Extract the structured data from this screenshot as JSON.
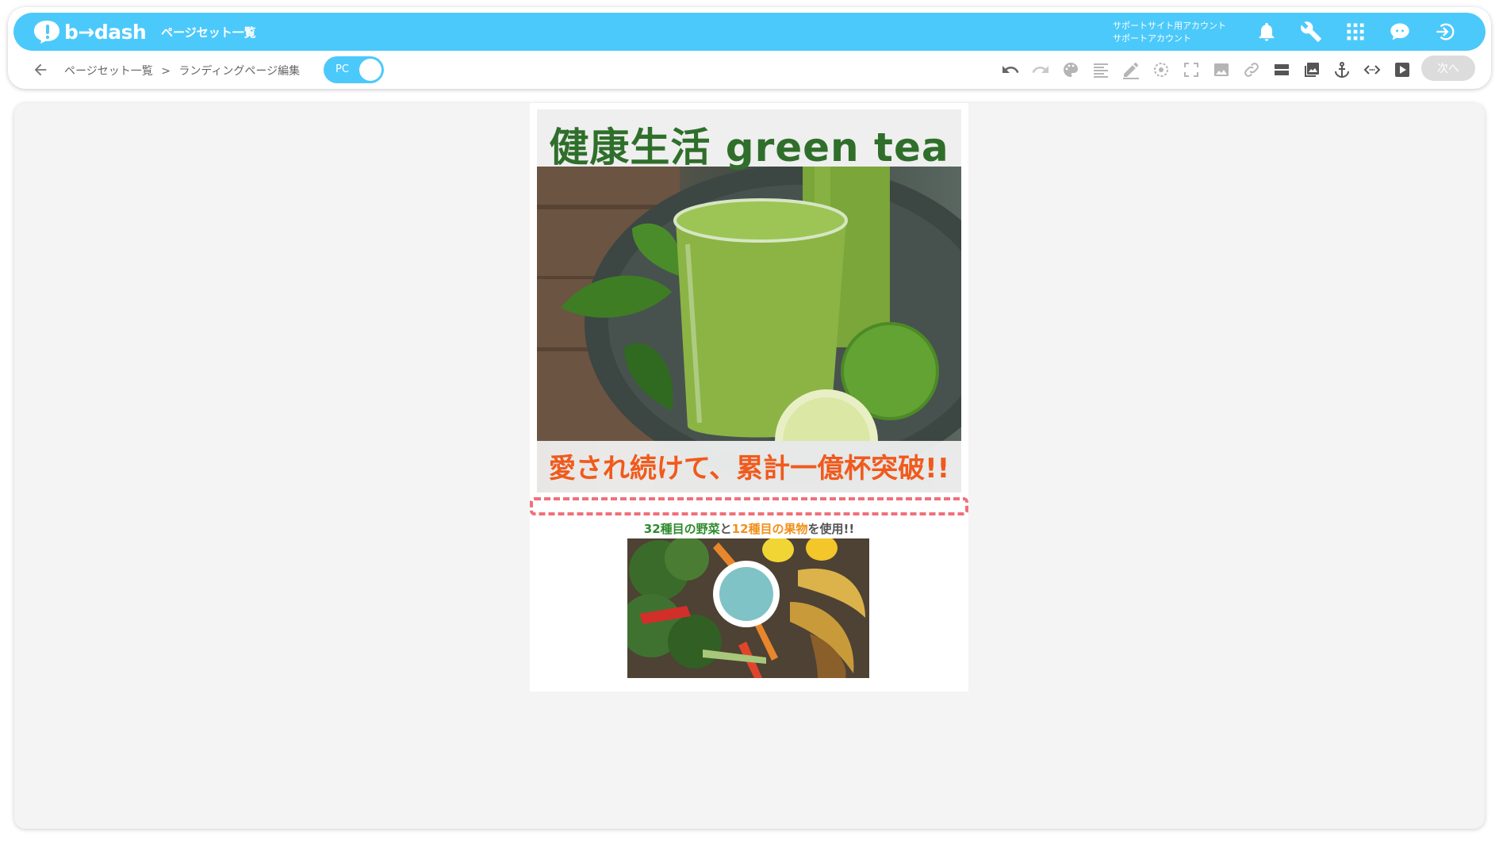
{
  "header": {
    "logo_text": "b→dash",
    "nav_title": "ページセット一覧",
    "account_line1": "サポートサイト用アカウント",
    "account_line2": "サポートアカウント",
    "icons": [
      "bell-icon",
      "wrench-icon",
      "apps-grid-icon",
      "support-chat-icon",
      "logout-icon"
    ]
  },
  "subbar": {
    "breadcrumb_root": "ページセット一覧",
    "breadcrumb_sep": ">",
    "breadcrumb_current": "ランディングページ編集",
    "device_toggle": "PC",
    "next_button": "次へ",
    "tools": [
      "undo-icon",
      "redo-icon",
      "palette-icon",
      "text-align-icon",
      "pen-icon",
      "target-icon",
      "fullscreen-icon",
      "image-icon",
      "link-icon",
      "block-icon",
      "gallery-icon",
      "anchor-icon",
      "code-icon",
      "video-icon"
    ]
  },
  "page": {
    "hero_title": "健康生活 green tea",
    "hero_tagline": "愛され続けて、累計一億杯突破!!",
    "section2": {
      "part1": "32種目の野菜",
      "part2": "と",
      "part3": "12種目の果物",
      "part4": "を使用!!"
    }
  },
  "colors": {
    "brand": "#4cc9fb",
    "title_green": "#2f6f2b",
    "tagline_orange": "#f05a1c",
    "selection_dash": "#f0707a"
  }
}
